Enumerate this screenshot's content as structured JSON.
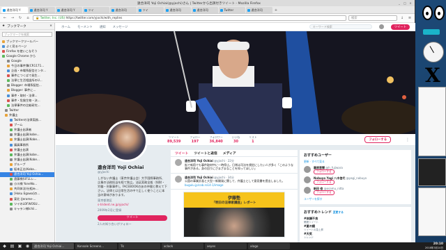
{
  "window": {
    "title": "遠合洋司 Yoji Ochiai(@yjochi)さん | Twitterから出演付きツイート - Mozilla Firefox"
  },
  "tabs": [
    {
      "label": "遠合洋司 Y"
    },
    {
      "label": "遠合洋司 Y"
    },
    {
      "label": "遠合洋司 Y"
    },
    {
      "label": "ツイ"
    },
    {
      "label": "遠合洋司"
    },
    {
      "label": "ツイ"
    },
    {
      "label": "遠合洋司"
    },
    {
      "label": "遠合洋司"
    },
    {
      "label": "Twitter"
    },
    {
      "label": "遠合洋司"
    }
  ],
  "nav": {
    "url": "https://twitter.com/yjochi/with_replies",
    "lock": "Twitter, Inc. (US)",
    "search_placeholder": "検索"
  },
  "sidebar": {
    "title": "ブックマーク",
    "search_placeholder": "ブックマークを検索",
    "items": [
      {
        "label": "ブックマークツールバー"
      },
      {
        "label": "よく見るページ"
      },
      {
        "label": "Firefox を使いこなそう"
      },
      {
        "label": "Google Chrome から"
      },
      {
        "label": "Google"
      },
      {
        "label": "今日の事件簿(CR1171..."
      },
      {
        "label": "企画・市場系配信センタ..."
      },
      {
        "label": "事件につくばで発生..."
      },
      {
        "label": "法律と生活相談所のU..."
      },
      {
        "label": "Blogger: 市場系配信..."
      },
      {
        "label": "Blogger: 事件に..."
      },
      {
        "label": "事件・取材・法律..."
      },
      {
        "label": "事件・危険生物・決..."
      },
      {
        "label": "法律事件の比較研究..."
      },
      {
        "label": "Twitter"
      },
      {
        "label": "弁護士"
      },
      {
        "label": "Twitterの法律実務..."
      },
      {
        "label": "ブーム"
      },
      {
        "label": "弁護士出演者"
      },
      {
        "label": "弁護士出演(kobe..."
      },
      {
        "label": "弁護士出演(Kobe..."
      },
      {
        "label": "議員事務所"
      },
      {
        "label": "弁護士出演"
      },
      {
        "label": "弁護士出演(kobe..."
      },
      {
        "label": "弁護士出演(Kobe..."
      },
      {
        "label": "グループ"
      },
      {
        "label": "坂本正志(Koba..."
      },
      {
        "label": "遠合洋司 Yoji Ochia..."
      },
      {
        "label": "遠藤様(UFLLレ..."
      },
      {
        "label": "小川様 YoneNo..."
      },
      {
        "label": "共同体法(仕組み..."
      },
      {
        "label": "[Hoku Egawa]の..."
      },
      {
        "label": "東北 (Jerome-..."
      },
      {
        "label": "ツイのLOFWOSU..."
      },
      {
        "label": "キャラン様Ichii..."
      }
    ]
  },
  "twitter": {
    "nav": [
      "ホーム",
      "モーメント",
      "通知",
      "メッセージ"
    ],
    "search_placeholder": "キーワード検索",
    "tweet_button": "ツイート",
    "stats": [
      {
        "label": "ツイート",
        "value": "89,539"
      },
      {
        "label": "フォロー",
        "value": "197"
      },
      {
        "label": "フォロワー",
        "value": "36,840"
      },
      {
        "label": "いいね",
        "value": "30"
      },
      {
        "label": "リスト",
        "value": "1"
      }
    ],
    "follow_button": "フォローする",
    "profile": {
      "name": "遠合洋司 Yoji Ochiai",
      "handle": "@yjochi",
      "bio": "しがない弁護士（東京弁護士会）大手国際事務所、企業の法務担当を経て独立。法廷実務全般（知財・労働・刑事事件）。FACEBOOKのあの仲間と教えて下さい。法律とは日常生活の中で正しく使うことに本当の意味があります。",
      "location": "東京都港区",
      "link": "s-trident.ne.jp/yjochi/",
      "joined": "2009年2月に登録",
      "photos_button": "ツイート",
      "followers_note": "2人の知り合いがフォロー"
    },
    "timeline_tabs": [
      "ツイート",
      "ツイートと返信",
      "メディア"
    ],
    "tweets": [
      {
        "author": "遠合洋司 Yoji Ochiai",
        "handle": "@yjochi · 22分",
        "text": "街で新宿でも事件取材中に一時停止。日常は司法を規定にしたい人が多く「このような事件がある。身の回りにさまざまなことを知ってほしい」"
      },
      {
        "author": "遠合洋司 Yoji Ochiai",
        "handle": "@yjochi · 34分",
        "text": "公園の事業計画と大型一新開発に関して、弁護士として意見書を提出しました。",
        "link": "bugulu.jp/cab.ro14-1/image"
      }
    ],
    "card": {
      "title": "伊藤塾",
      "subtitle": "「明日の法律家講座」レポート"
    },
    "who_to_follow": {
      "title": "おすすめユーザー",
      "refresh": "更新 · すべて見る",
      "users": [
        {
          "name": "藤原恵輝",
          "handle": "@h_fujiwara",
          "btn": "フォローする"
        },
        {
          "name": "Nobuyo Yagi 八木信代",
          "handle": "@yagi_nobuyo",
          "btn": "フォローする"
        },
        {
          "name": "新田 修",
          "handle": "@osamu_nitta",
          "btn": "フォローする"
        }
      ],
      "more": "ユーザーを探す"
    },
    "trends": {
      "title": "おすすめトレンド",
      "change": "変更する",
      "items": [
        {
          "name": "#体調不良",
          "sub": "関連ツイート"
        },
        {
          "name": "#夏の鏡",
          "sub": "ツイートの急上昇"
        },
        {
          "name": "#天気",
          "sub": "トレンド"
        },
        {
          "name": "#大分",
          "sub": "トレンド"
        }
      ]
    }
  },
  "taskbar": {
    "tasks": [
      {
        "label": "遠合洋司 Yoji Ochiai..."
      },
      {
        "label": "Konsole Screens..."
      },
      {
        "label": "Tk"
      },
      {
        "label": "xclock"
      },
      {
        "label": "xeyes"
      },
      {
        "label": "xlogo"
      }
    ],
    "clock_time": "20:10",
    "clock_date": "2018年3月14日"
  },
  "colors": {
    "accent": "#e0245e",
    "link": "#1b95e0",
    "taskbar": "#1e1e1e"
  }
}
